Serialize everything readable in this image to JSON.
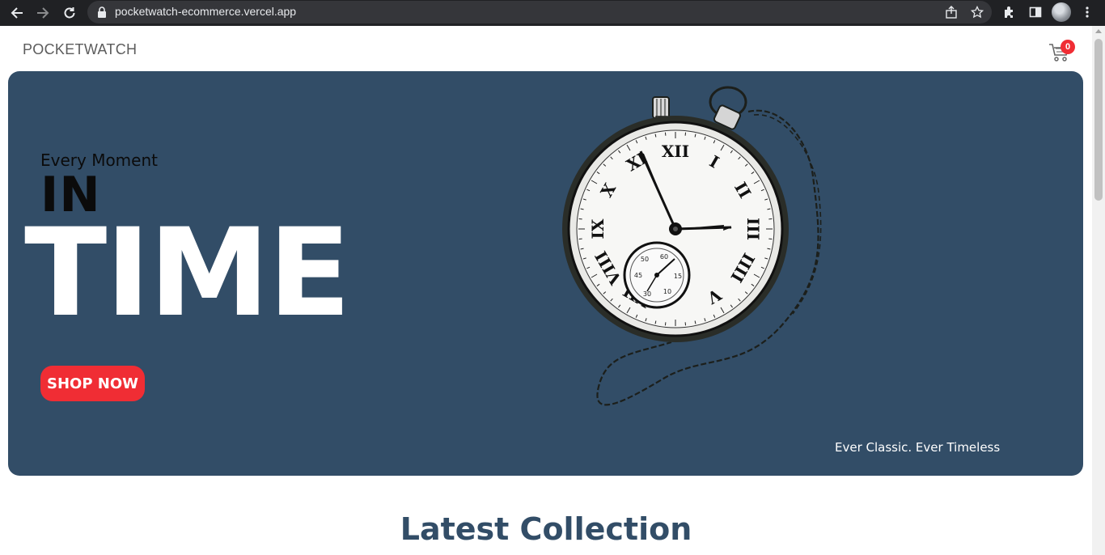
{
  "browser": {
    "url": "pocketwatch-ecommerce.vercel.app"
  },
  "navbar": {
    "brand": "POCKETWATCH",
    "cart_count": "0"
  },
  "hero": {
    "small_text": "Every Moment",
    "mid_text": "IN",
    "large_text": "TIME",
    "button_label": "SHOP NOW",
    "tagline": "Ever Classic. Ever Timeless",
    "background_color": "#324d67",
    "button_color": "#f02d34"
  },
  "collection": {
    "title": "Latest Collection"
  },
  "watch_numerals": [
    "XII",
    "I",
    "II",
    "III",
    "IIII",
    "V",
    "VII",
    "VIII",
    "IX",
    "X",
    "XI"
  ],
  "subdial_numbers": [
    "60",
    "15",
    "30",
    "45",
    "50",
    "10"
  ]
}
